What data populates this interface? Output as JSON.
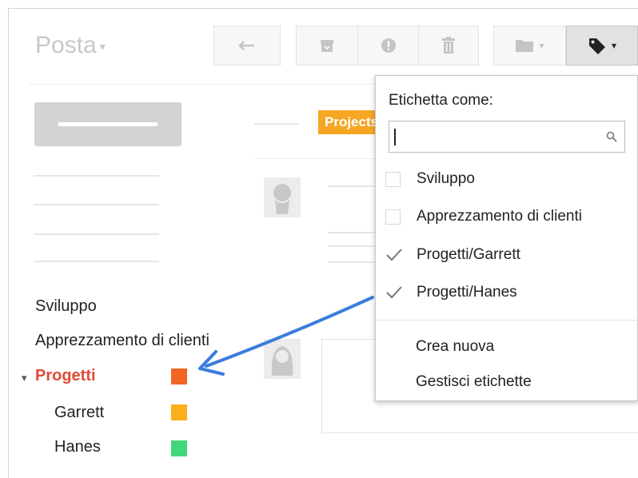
{
  "header": {
    "title": "Posta",
    "title_caret": "▾"
  },
  "toolbar": {
    "reply_icon": "reply-arrow-icon",
    "archive_icon": "archive-icon",
    "spam_icon": "report-spam-icon",
    "delete_icon": "trash-icon",
    "move_icon": "folder-icon",
    "labels_icon": "label-tag-icon",
    "caret": "▾"
  },
  "sidebar": {
    "labels": [
      {
        "name": "Sviluppo"
      },
      {
        "name": "Apprezzamento di clienti"
      }
    ],
    "group": {
      "toggle": "▾",
      "name": "Progetti",
      "color": "#f26522"
    },
    "sublabels": [
      {
        "name": "Garrett",
        "color": "#fbaf1b"
      },
      {
        "name": "Hanes",
        "color": "#41d67c"
      }
    ]
  },
  "message_list": {
    "label_chip": "Projects"
  },
  "label_menu": {
    "title": "Etichetta come:",
    "search_value": "",
    "search_icon": "magnifier-icon",
    "items": [
      {
        "label": "Sviluppo",
        "checked": false
      },
      {
        "label": "Apprezzamento di clienti",
        "checked": false
      },
      {
        "label": "Progetti/Garrett",
        "checked": true
      },
      {
        "label": "Progetti/Hanes",
        "checked": true
      }
    ],
    "create": "Crea nuova",
    "manage": "Gestisci etichette"
  },
  "colors": {
    "accent_red": "#dd4b39",
    "arrow_blue": "#3b7ddd",
    "chip_orange": "#f5a623"
  }
}
